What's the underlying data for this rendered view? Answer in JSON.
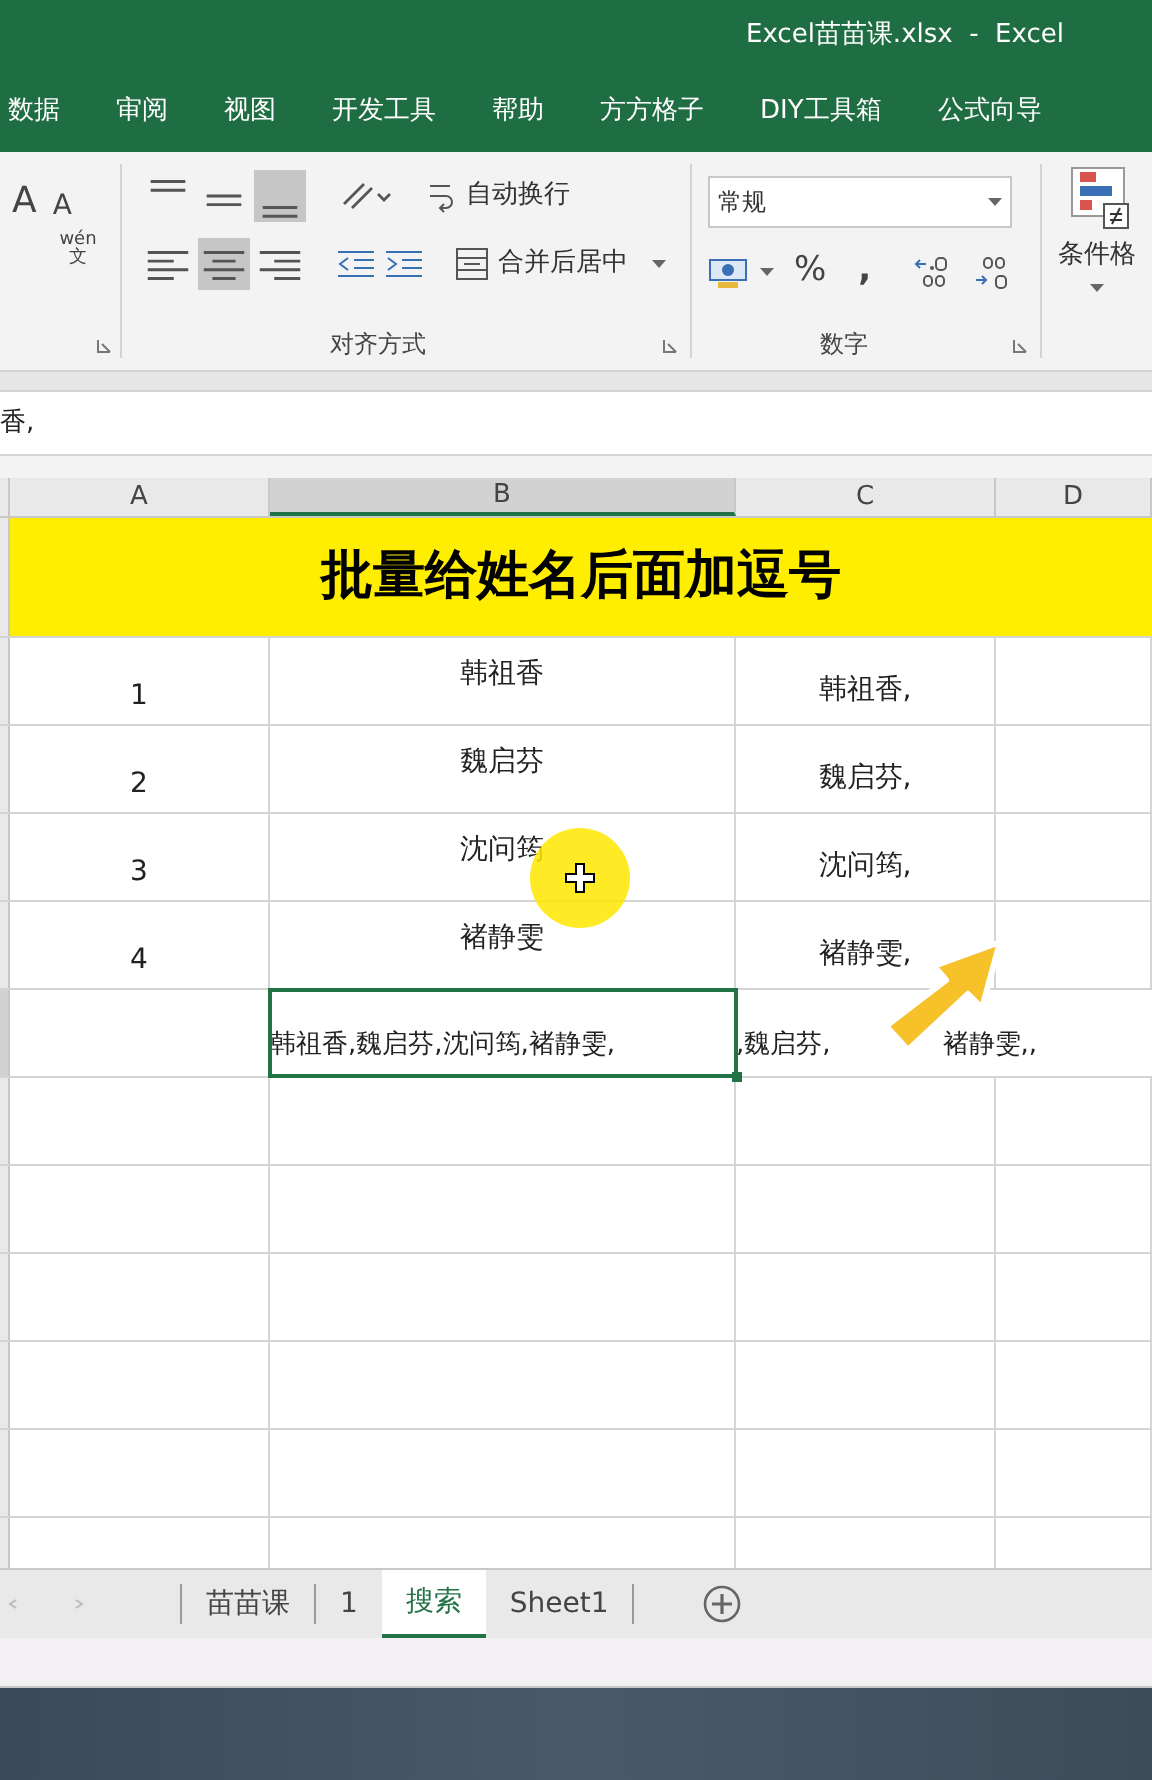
{
  "window": {
    "title": "Excel苗苗课.xlsx  -  Excel"
  },
  "menu_tabs": [
    {
      "label": "数据",
      "selected": false
    },
    {
      "label": "审阅",
      "selected": false
    },
    {
      "label": "视图",
      "selected": false
    },
    {
      "label": "开发工具",
      "selected": false
    },
    {
      "label": "帮助",
      "selected": false
    },
    {
      "label": "方方格子",
      "selected": false
    },
    {
      "label": "DIY工具箱",
      "selected": false
    },
    {
      "label": "公式向导",
      "selected": false
    }
  ],
  "ribbon": {
    "font_grow": "A",
    "font_shrink": "A",
    "phonetic_top": "wén",
    "phonetic_bottom": "文",
    "vertical_align": [
      {
        "selected": false
      },
      {
        "selected": false
      },
      {
        "selected": true
      }
    ],
    "horizontal_align": [
      {
        "selected": false
      },
      {
        "selected": true
      },
      {
        "selected": false
      }
    ],
    "wrap_text": "自动换行",
    "merge_center": "合并后居中",
    "alignment_label": "对齐方式",
    "number_format": "常规",
    "percent": "%",
    "comma": ",",
    "number_label": "数字",
    "conditional_format": "条件格"
  },
  "formula_bar": {
    "value": "香,"
  },
  "columns": [
    {
      "label": "A",
      "selected": false
    },
    {
      "label": "B",
      "selected": true
    },
    {
      "label": "C",
      "selected": false
    },
    {
      "label": "D",
      "selected": false
    }
  ],
  "title_row": "批量给姓名后面加逗号",
  "rows": [
    {
      "a": "1",
      "b": "韩祖香",
      "c": "韩祖香,"
    },
    {
      "a": "2",
      "b": "魏启芬",
      "c": "魏启芬,"
    },
    {
      "a": "3",
      "b": "沈问筠",
      "c": "沈问筠,"
    },
    {
      "a": "4",
      "b": "褚静雯",
      "c": "褚静雯,"
    }
  ],
  "joined_row": {
    "b": "韩祖香,魏启芬,沈问筠,褚静雯,",
    "c_parts": [
      ",魏启芬,",
      "褚静雯,,"
    ],
    "selected": true
  },
  "sheet_tabs": [
    {
      "label": "苗苗课",
      "selected": false
    },
    {
      "label": "1",
      "selected": false
    },
    {
      "label": "搜索",
      "selected": true
    },
    {
      "label": "Sheet1",
      "selected": false
    }
  ]
}
